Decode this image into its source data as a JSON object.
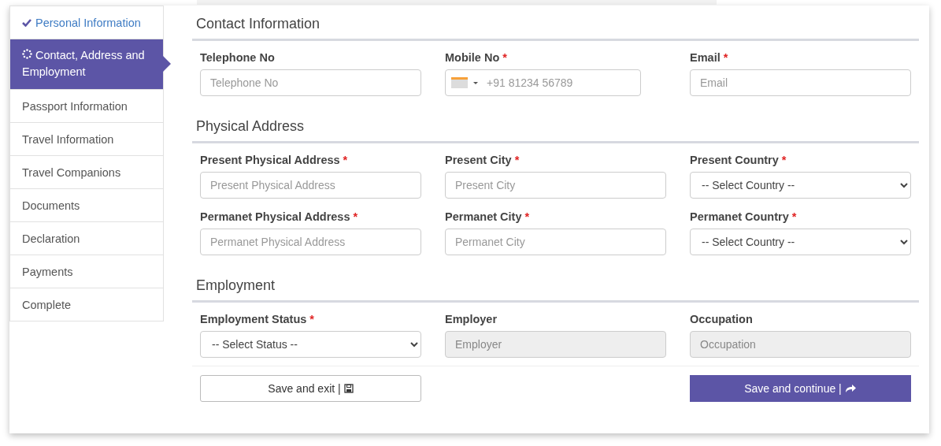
{
  "steps": [
    {
      "label": "Personal Information",
      "selected": false,
      "completed": true
    },
    {
      "label": "Contact, Address and Employment",
      "selected": true,
      "completed": false
    },
    {
      "label": "Passport Information",
      "selected": false,
      "completed": false
    },
    {
      "label": "Travel Information",
      "selected": false,
      "completed": false
    },
    {
      "label": "Travel Companions",
      "selected": false,
      "completed": false
    },
    {
      "label": "Documents",
      "selected": false,
      "completed": false
    },
    {
      "label": "Declaration",
      "selected": false,
      "completed": false
    },
    {
      "label": "Payments",
      "selected": false,
      "completed": false
    },
    {
      "label": "Complete",
      "selected": false,
      "completed": false
    }
  ],
  "sections": [
    {
      "title": "Contact Information",
      "fields": [
        {
          "kind": "text",
          "label": "Telephone No",
          "disabled": false,
          "placeholder": "Telephone No"
        },
        {
          "kind": "phone",
          "label": "Mobile No",
          "required_mark": "*",
          "placeholder": "+91 81234 56789"
        },
        {
          "kind": "text",
          "label": "Email",
          "required_mark": "*",
          "disabled": false,
          "placeholder": "Email"
        }
      ]
    },
    {
      "title": "Physical Address",
      "fields": [
        {
          "kind": "text",
          "label": "Present Physical Address",
          "required_mark": "*",
          "disabled": false,
          "placeholder": "Present Physical Address"
        },
        {
          "kind": "text",
          "label": "Present City",
          "required_mark": "*",
          "disabled": false,
          "placeholder": "Present City"
        },
        {
          "kind": "select",
          "label": "Present Country",
          "required_mark": "*",
          "value": "-- Select Country --"
        },
        {
          "kind": "text",
          "label": "Permanet Physical Address",
          "required_mark": "*",
          "disabled": false,
          "placeholder": "Permanet Physical Address"
        },
        {
          "kind": "text",
          "label": "Permanet City",
          "required_mark": "*",
          "disabled": false,
          "placeholder": "Permanet City"
        },
        {
          "kind": "select",
          "label": "Permanet Country",
          "required_mark": "*",
          "value": "-- Select Country --"
        }
      ]
    },
    {
      "title": "Employment",
      "fields": [
        {
          "kind": "select",
          "label": "Employment Status",
          "required_mark": "*",
          "value": "-- Select Status --"
        },
        {
          "kind": "text",
          "label": "Employer",
          "disabled": true,
          "placeholder": "Employer"
        },
        {
          "kind": "text",
          "label": "Occupation",
          "disabled": true,
          "placeholder": "Occupation"
        }
      ]
    }
  ],
  "buttons": [
    {
      "label": "Save and exit |",
      "kind": "secondary"
    },
    {
      "label": "Save and continue |",
      "kind": "primary"
    }
  ]
}
